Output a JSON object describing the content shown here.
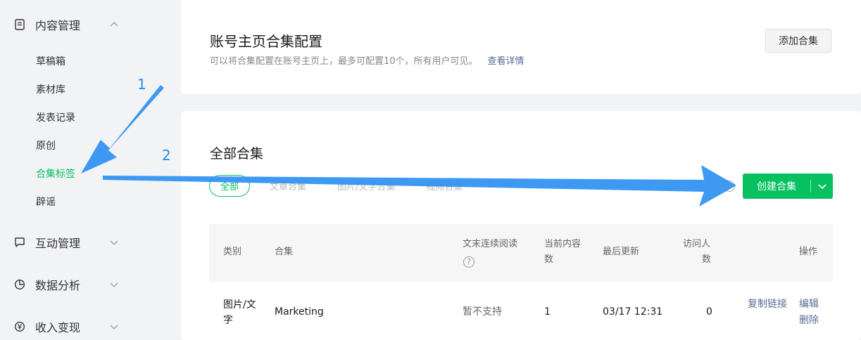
{
  "sidebar": {
    "content_mgmt": "内容管理",
    "sub_items": [
      "草稿箱",
      "素材库",
      "发表记录",
      "原创",
      "合集标签",
      "辟谣"
    ],
    "interaction_mgmt": "互动管理",
    "data_analysis": "数据分析",
    "monetization": "收入变现"
  },
  "config_card": {
    "title": "账号主页合集配置",
    "description": "可以将合集配置在账号主页上，最多可配置10个，所有用户可见。",
    "details_link": "查看详情",
    "add_button": "添加合集"
  },
  "all_card": {
    "title": "全部合集",
    "filters": [
      "全部",
      "文章合集",
      "图片/文字合集",
      "视频合集"
    ],
    "create_button": "创建合集"
  },
  "table": {
    "headers": {
      "type": "类别",
      "collection": "合集",
      "continuous_read_line1": "文末连续阅读",
      "current_count_line1": "当前内容",
      "current_count_line2": "数",
      "last_update": "最后更新",
      "visitors_line1": "访问人",
      "visitors_line2": "数",
      "actions": "操作"
    },
    "rows": [
      {
        "type_line1": "图片/文",
        "type_line2": "字",
        "name": "Marketing",
        "continuous": "暂不支持",
        "count": "1",
        "updated": "03/17 12:31",
        "visitors": "0",
        "copy_link": "复制链接",
        "edit": "编辑",
        "delete": "删除"
      }
    ]
  },
  "annotations": {
    "step1": "1",
    "step2": "2"
  },
  "colors": {
    "accent": "#07c160",
    "link": "#576b95",
    "arrow": "#2a8cf0"
  }
}
